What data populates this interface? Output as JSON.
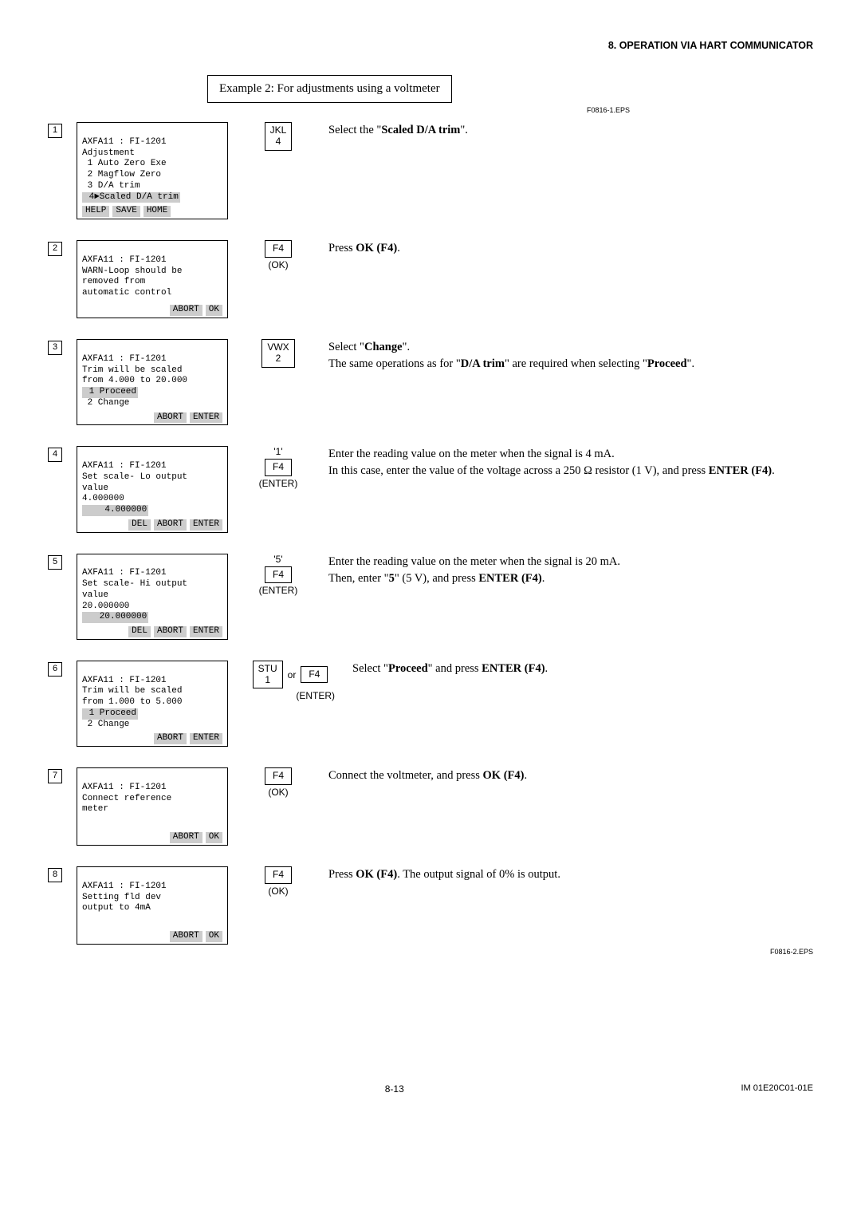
{
  "header": {
    "section": "8.  OPERATION VIA HART COMMUNICATOR"
  },
  "example": "Example 2: For adjustments using a voltmeter",
  "eps_top": "F0816-1.EPS",
  "eps_bottom": "F0816-2.EPS",
  "steps": {
    "s1": {
      "num": "1",
      "title": "AXFA11 : FI-1201",
      "l1": "Adjustment",
      "l2": " 1 Auto Zero Exe",
      "l3": " 2 Magflow Zero",
      "l4": " 3 D/A trim",
      "hl": " 4►Scaled D/A trim",
      "sk1": "HELP",
      "sk2": "SAVE",
      "sk3": "HOME",
      "key_top": "JKL",
      "key_bot": "4",
      "desc_a": "Select the \"",
      "desc_b": "Scaled D/A trim",
      "desc_c": "\"."
    },
    "s2": {
      "num": "2",
      "title": "AXFA11 : FI-1201",
      "l1": "WARN-Loop should be",
      "l2": "removed from",
      "l3": "automatic control",
      "sk1": "ABORT",
      "sk2": "OK",
      "key": "F4",
      "key_sub": "(OK)",
      "desc_a": "Press ",
      "desc_b": "OK (F4)",
      "desc_c": "."
    },
    "s3": {
      "num": "3",
      "title": "AXFA11 : FI-1201",
      "l1": "Trim will be scaled",
      "l2": "from 4.000 to 20.000",
      "hl": " 1 Proceed",
      "l4": " 2 Change",
      "sk1": "ABORT",
      "sk2": "ENTER",
      "key_top": "VWX",
      "key_bot": "2",
      "desc_a": "Select \"",
      "desc_b": "Change",
      "desc_c": "\".",
      "desc_d": "The same operations as for \"",
      "desc_e": "D/A trim",
      "desc_f": "\" are required when selecting \"",
      "desc_g": "Proceed",
      "desc_h": "\"."
    },
    "s4": {
      "num": "4",
      "title": "AXFA11 : FI-1201",
      "l1": "Set scale- Lo output",
      "l2": "value",
      "l3": "4.000000",
      "hl": "    4.000000",
      "sk1": "DEL",
      "sk2": "ABORT",
      "sk3": "ENTER",
      "key_pre": "'1'",
      "key": "F4",
      "key_sub": "(ENTER)",
      "desc_a": "Enter the reading value on the meter when the signal is 4 mA.",
      "desc_b": "In this case, enter the value of the voltage across a 250 Ω resistor (1 V), and press ",
      "desc_c": "ENTER (F4)",
      "desc_d": "."
    },
    "s5": {
      "num": "5",
      "title": "AXFA11 : FI-1201",
      "l1": "Set scale- Hi output",
      "l2": "value",
      "l3": "20.000000",
      "hl": "   20.000000",
      "sk1": "DEL",
      "sk2": "ABORT",
      "sk3": "ENTER",
      "key_pre": "'5'",
      "key": "F4",
      "key_sub": "(ENTER)",
      "desc_a": "Enter the reading value on the meter when the signal is 20 mA.",
      "desc_b": "Then, enter \"",
      "desc_c": "5",
      "desc_d": "\" (5 V), and press ",
      "desc_e": "ENTER (F4)",
      "desc_f": "."
    },
    "s6": {
      "num": "6",
      "title": "AXFA11 : FI-1201",
      "l1": "Trim will be scaled",
      "l2": "from 1.000 to 5.000",
      "hl": " 1 Proceed",
      "l4": " 2 Change",
      "sk1": "ABORT",
      "sk2": "ENTER",
      "keyA_top": "STU",
      "keyA_bot": "1",
      "or": "or",
      "keyB": "F4",
      "key_sub": "(ENTER)",
      "desc_a": "Select \"",
      "desc_b": "Proceed",
      "desc_c": "\" and press ",
      "desc_d": "ENTER (F4)",
      "desc_e": "."
    },
    "s7": {
      "num": "7",
      "title": "AXFA11 : FI-1201",
      "l1": "Connect reference",
      "l2": "meter",
      "sk1": "ABORT",
      "sk2": "OK",
      "key": "F4",
      "key_sub": "(OK)",
      "desc_a": "Connect the voltmeter, and press ",
      "desc_b": "OK (F4)",
      "desc_c": "."
    },
    "s8": {
      "num": "8",
      "title": "AXFA11 : FI-1201",
      "l1": "Setting fld dev",
      "l2": "output to 4mA",
      "sk1": "ABORT",
      "sk2": "OK",
      "key": "F4",
      "key_sub": "(OK)",
      "desc_a": "Press ",
      "desc_b": "OK (F4)",
      "desc_c": ". The output signal of 0% is output."
    }
  },
  "footer": {
    "page": "8-13",
    "doc": "IM 01E20C01-01E"
  }
}
